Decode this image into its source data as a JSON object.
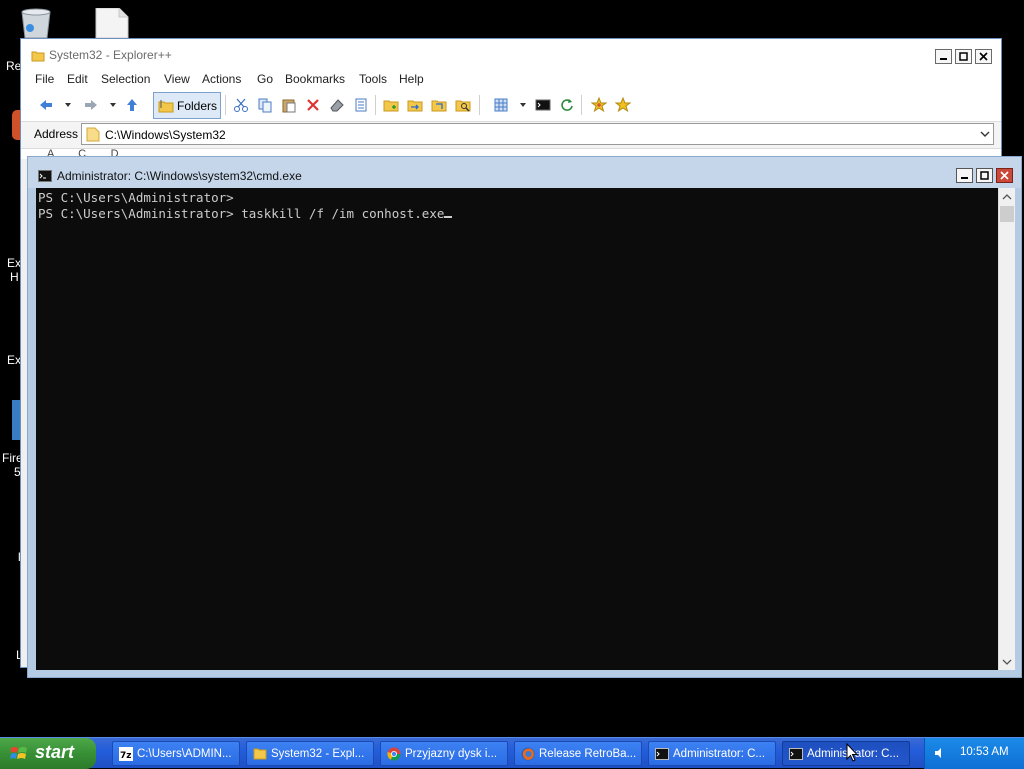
{
  "desktop": {
    "labels": [
      "Re",
      "Ex",
      "H",
      "Ex",
      "Fire",
      "5",
      "l",
      "L"
    ]
  },
  "explorer": {
    "title": "System32 - Explorer++",
    "menu": [
      "File",
      "Edit",
      "Selection",
      "View",
      "Actions",
      "Go",
      "Bookmarks",
      "Tools",
      "Help"
    ],
    "folders_label": "Folders",
    "address_label": "Address",
    "address_value": "C:\\Windows\\System32",
    "partial_row": "A        C        D"
  },
  "cmd": {
    "title": "Administrator: C:\\Windows\\system32\\cmd.exe",
    "lines": [
      "PS C:\\Users\\Administrator>",
      "PS C:\\Users\\Administrator> taskkill /f /im conhost.exe"
    ]
  },
  "taskbar": {
    "start_label": "start",
    "tasks": [
      {
        "label": "C:\\Users\\ADMIN...",
        "icon": "7zip-icon"
      },
      {
        "label": "System32 - Expl...",
        "icon": "folder-icon"
      },
      {
        "label": "Przyjazny dysk i...",
        "icon": "chrome-icon"
      },
      {
        "label": "Release RetroBa...",
        "icon": "firefox-icon"
      },
      {
        "label": "Administrator: C...",
        "icon": "cmd-icon"
      },
      {
        "label": "Administrator: C...",
        "icon": "cmd-icon"
      }
    ],
    "clock": "10:53 AM"
  },
  "colors": {
    "taskbar": "#245edb",
    "start": "#379035",
    "console_bg": "#0c0c0c",
    "console_fg": "#cccccc"
  }
}
